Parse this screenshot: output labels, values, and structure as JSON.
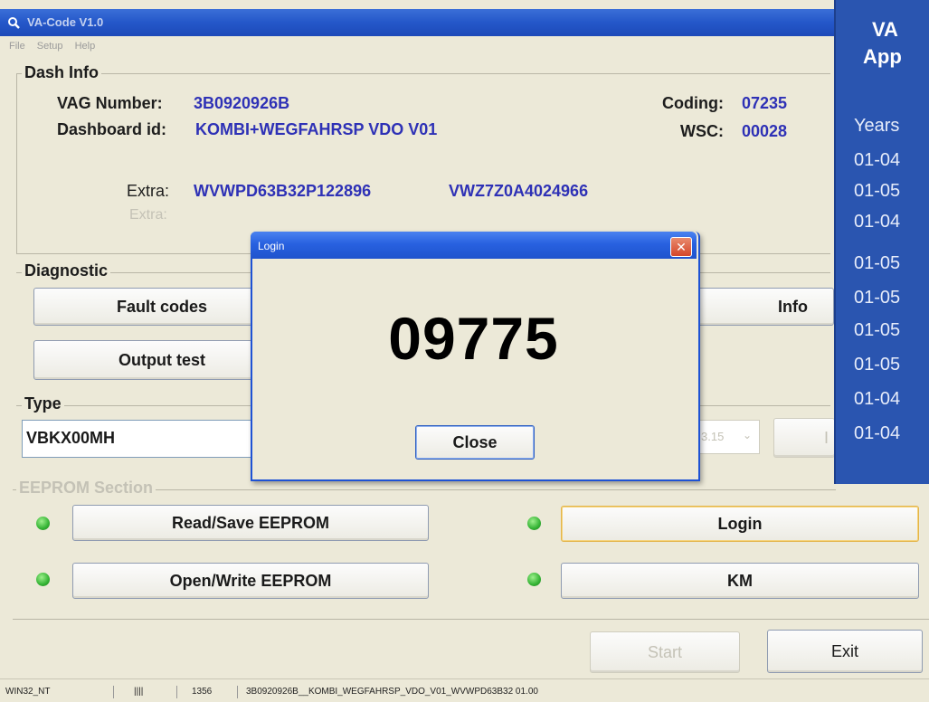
{
  "window": {
    "title": "VA-Code V1.0",
    "menu": [
      "File",
      "Setup",
      "Help"
    ]
  },
  "dash_info": {
    "group_title": "Dash Info",
    "vag_number_label": "VAG Number:",
    "vag_number": "3B0920926B",
    "dashboard_id_label": "Dashboard id:",
    "dashboard_id": "KOMBI+WEGFAHRSP VDO V01",
    "coding_label": "Coding:",
    "coding": "07235",
    "wsc_label": "WSC:",
    "wsc": "00028",
    "extra_label": "Extra:",
    "extra_1": "WVWPD63B32P122896",
    "extra_2": "VWZ7Z0A4024966",
    "extra2_label": "Extra:"
  },
  "diagnostic": {
    "group_title": "Diagnostic",
    "fault_codes": "Fault codes",
    "output_test": "Output test",
    "info": "Info"
  },
  "type_section": {
    "group_title": "Type",
    "value": "VBKX00MH",
    "select_value": "3.15",
    "right_button_partial": "I"
  },
  "eeprom": {
    "group_title": "EEPROM Section",
    "read_save": "Read/Save EEPROM",
    "open_write": "Open/Write EEPROM",
    "login": "Login",
    "km": "KM"
  },
  "actions": {
    "start": "Start",
    "exit": "Exit"
  },
  "status_bar": {
    "os": "WIN32_NT",
    "bars": "||||",
    "num": "1356",
    "info": "3B0920926B__KOMBI_WEGFAHRSP_VDO_V01_WVWPD63B32 01.00"
  },
  "login_dialog": {
    "title": "Login",
    "code": "09775",
    "close": "Close"
  },
  "side_panel": {
    "heading_1": "VA",
    "heading_2": "App",
    "years_label": "Years",
    "years": [
      "01-04",
      "01-05",
      "01-04",
      "01-05",
      "01-05",
      "01-05",
      "01-05",
      "01-04",
      "01-04"
    ]
  },
  "colors": {
    "value_blue": "#2e31b6",
    "titlebar_blue": "#2457c9",
    "led_green": "#34b334",
    "panel_blue": "#2a55b0"
  }
}
